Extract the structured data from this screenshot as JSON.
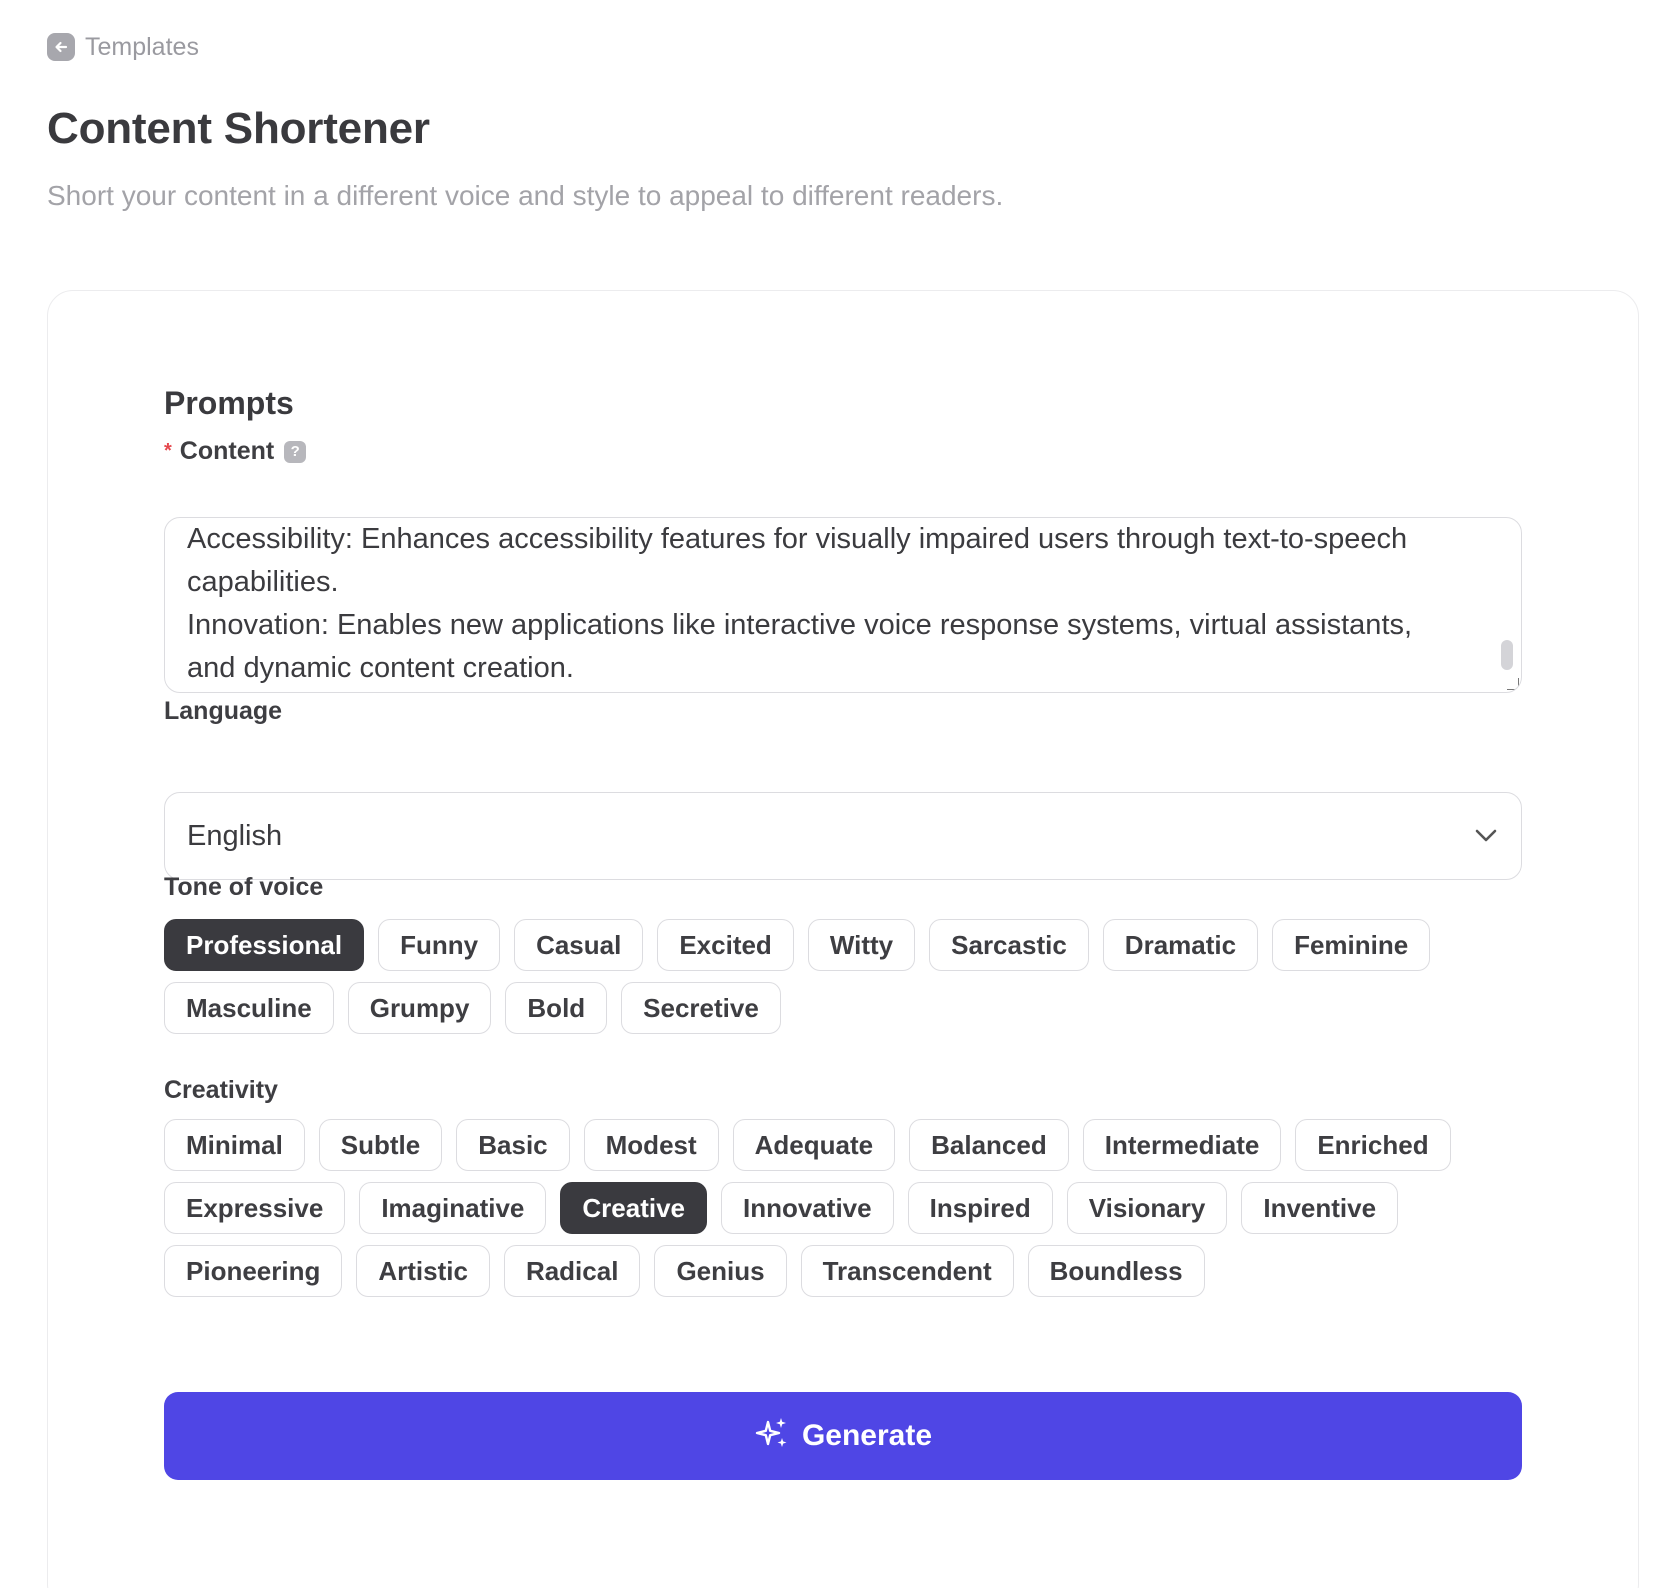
{
  "back": {
    "label": "Templates",
    "icon": "arrow-left-icon"
  },
  "page": {
    "title": "Content Shortener",
    "subtitle": "Short your content in a different voice and style to appeal to different readers."
  },
  "form": {
    "section_title": "Prompts",
    "content": {
      "label": "Content",
      "required_mark": "*",
      "help_glyph": "?",
      "value": "Accessibility: Enhances accessibility features for visually impaired users through text-to-speech capabilities.\nInnovation: Enables new applications like interactive voice response systems, virtual assistants, and dynamic content creation."
    },
    "language": {
      "label": "Language",
      "selected": "English"
    },
    "tone": {
      "label": "Tone of voice",
      "rows": [
        [
          "Professional",
          "Funny",
          "Casual",
          "Excited",
          "Witty",
          "Sarcastic",
          "Dramatic",
          "Feminine"
        ],
        [
          "Masculine",
          "Grumpy",
          "Bold",
          "Secretive"
        ]
      ],
      "selected": "Professional"
    },
    "creativity": {
      "label": "Creativity",
      "rows": [
        [
          "Minimal",
          "Subtle",
          "Basic",
          "Modest",
          "Adequate",
          "Balanced",
          "Intermediate",
          "Enriched"
        ],
        [
          "Expressive",
          "Imaginative",
          "Creative",
          "Innovative",
          "Inspired",
          "Visionary",
          "Inventive"
        ],
        [
          "Pioneering",
          "Artistic",
          "Radical",
          "Genius",
          "Transcendent",
          "Boundless"
        ]
      ],
      "selected": "Creative"
    },
    "generate": {
      "label": "Generate",
      "icon": "sparkles-icon"
    }
  },
  "colors": {
    "accent": "#4f46e5",
    "chip_selected": "#3a3a3f",
    "required": "#e5484d"
  }
}
